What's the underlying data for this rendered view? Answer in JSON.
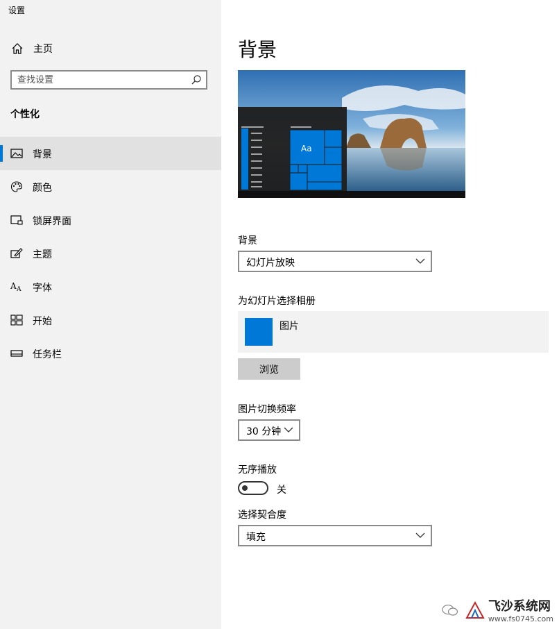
{
  "app": {
    "title": "设置"
  },
  "sidebar": {
    "home_label": "主页",
    "search_placeholder": "查找设置",
    "section_title": "个性化",
    "items": [
      {
        "label": "背景",
        "icon": "image-icon",
        "active": true
      },
      {
        "label": "颜色",
        "icon": "palette-icon",
        "active": false
      },
      {
        "label": "锁屏界面",
        "icon": "lock-screen-icon",
        "active": false
      },
      {
        "label": "主题",
        "icon": "theme-brush-icon",
        "active": false
      },
      {
        "label": "字体",
        "icon": "font-icon",
        "active": false
      },
      {
        "label": "开始",
        "icon": "start-grid-icon",
        "active": false
      },
      {
        "label": "任务栏",
        "icon": "taskbar-icon",
        "active": false
      }
    ]
  },
  "main": {
    "title": "背景",
    "preview": {
      "tile_label": "Aa"
    },
    "background": {
      "label": "背景",
      "value": "幻灯片放映"
    },
    "album": {
      "label": "为幻灯片选择相册",
      "name": "图片",
      "browse_label": "浏览"
    },
    "interval": {
      "label": "图片切换频率",
      "value": "30 分钟"
    },
    "shuffle": {
      "label": "无序播放",
      "state_label": "关",
      "on": false
    },
    "fit": {
      "label": "选择契合度",
      "value": "填充"
    }
  },
  "watermark": {
    "brand": "飞沙系统网",
    "url": "www.fs0745.com"
  },
  "colors": {
    "accent": "#0078d7",
    "sidebar_bg": "#f2f2f2",
    "active_bg": "#e1e1e1"
  }
}
